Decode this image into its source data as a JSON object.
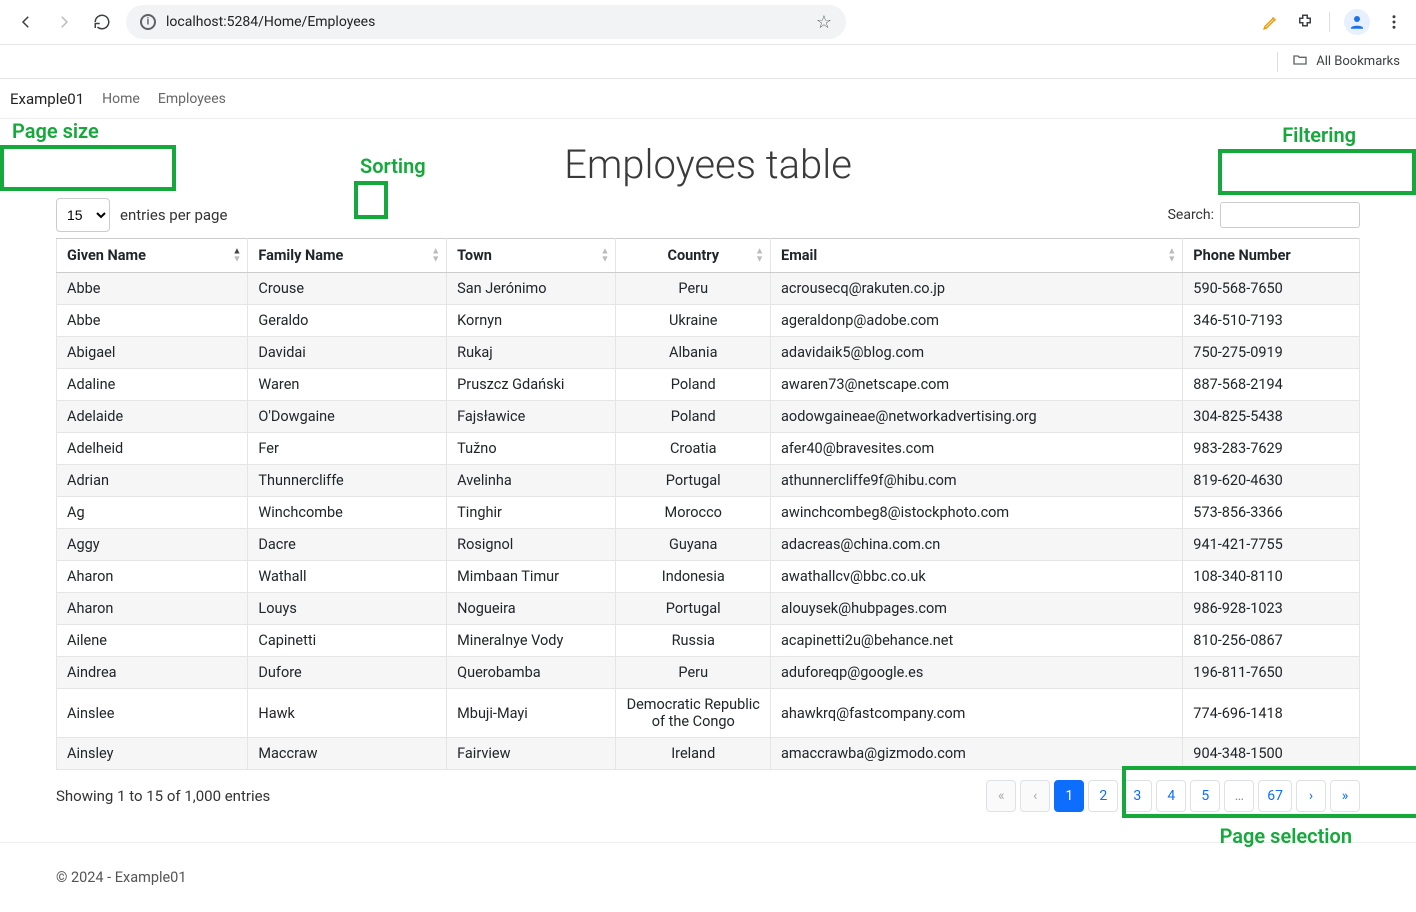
{
  "browser": {
    "url": "localhost:5284/Home/Employees",
    "all_bookmarks": "All Bookmarks"
  },
  "nav": {
    "brand": "Example01",
    "links": [
      "Home",
      "Employees"
    ]
  },
  "annotations": {
    "page_size": "Page size",
    "sorting": "Sorting",
    "filtering": "Filtering",
    "page_selection": "Page selection"
  },
  "page": {
    "title": "Employees table",
    "length_value": "15",
    "length_suffix": "entries per page",
    "search_label": "Search:",
    "search_value": "",
    "info": "Showing 1 to 15 of 1,000 entries"
  },
  "columns": [
    {
      "label": "Given Name",
      "center": false
    },
    {
      "label": "Family Name",
      "center": false
    },
    {
      "label": "Town",
      "center": false
    },
    {
      "label": "Country",
      "center": true
    },
    {
      "label": "Email",
      "center": false
    },
    {
      "label": "Phone Number",
      "center": false
    }
  ],
  "rows": [
    {
      "given": "Abbe",
      "family": "Crouse",
      "town": "San Jerónimo",
      "country": "Peru",
      "email": "acrousecq@rakuten.co.jp",
      "phone": "590-568-7650"
    },
    {
      "given": "Abbe",
      "family": "Geraldo",
      "town": "Kornyn",
      "country": "Ukraine",
      "email": "ageraldonp@adobe.com",
      "phone": "346-510-7193"
    },
    {
      "given": "Abigael",
      "family": "Davidai",
      "town": "Rukaj",
      "country": "Albania",
      "email": "adavidaik5@blog.com",
      "phone": "750-275-0919"
    },
    {
      "given": "Adaline",
      "family": "Waren",
      "town": "Pruszcz Gdański",
      "country": "Poland",
      "email": "awaren73@netscape.com",
      "phone": "887-568-2194"
    },
    {
      "given": "Adelaide",
      "family": "O'Dowgaine",
      "town": "Fajsławice",
      "country": "Poland",
      "email": "aodowgaineae@networkadvertising.org",
      "phone": "304-825-5438"
    },
    {
      "given": "Adelheid",
      "family": "Fer",
      "town": "Tužno",
      "country": "Croatia",
      "email": "afer40@bravesites.com",
      "phone": "983-283-7629"
    },
    {
      "given": "Adrian",
      "family": "Thunnercliffe",
      "town": "Avelinha",
      "country": "Portugal",
      "email": "athunnercliffe9f@hibu.com",
      "phone": "819-620-4630"
    },
    {
      "given": "Ag",
      "family": "Winchcombe",
      "town": "Tinghir",
      "country": "Morocco",
      "email": "awinchcombeg8@istockphoto.com",
      "phone": "573-856-3366"
    },
    {
      "given": "Aggy",
      "family": "Dacre",
      "town": "Rosignol",
      "country": "Guyana",
      "email": "adacreas@china.com.cn",
      "phone": "941-421-7755"
    },
    {
      "given": "Aharon",
      "family": "Wathall",
      "town": "Mimbaan Timur",
      "country": "Indonesia",
      "email": "awathallcv@bbc.co.uk",
      "phone": "108-340-8110"
    },
    {
      "given": "Aharon",
      "family": "Louys",
      "town": "Nogueira",
      "country": "Portugal",
      "email": "alouysek@hubpages.com",
      "phone": "986-928-1023"
    },
    {
      "given": "Ailene",
      "family": "Capinetti",
      "town": "Mineralnye Vody",
      "country": "Russia",
      "email": "acapinetti2u@behance.net",
      "phone": "810-256-0867"
    },
    {
      "given": "Aindrea",
      "family": "Dufore",
      "town": "Querobamba",
      "country": "Peru",
      "email": "aduforeqp@google.es",
      "phone": "196-811-7650"
    },
    {
      "given": "Ainslee",
      "family": "Hawk",
      "town": "Mbuji-Mayi",
      "country": "Democratic Republic of the Congo",
      "email": "ahawkrq@fastcompany.com",
      "phone": "774-696-1418"
    },
    {
      "given": "Ainsley",
      "family": "Maccraw",
      "town": "Fairview",
      "country": "Ireland",
      "email": "amaccrawba@gizmodo.com",
      "phone": "904-348-1500"
    }
  ],
  "pagination": {
    "first": "«",
    "prev": "‹",
    "pages": [
      "1",
      "2",
      "3",
      "4",
      "5"
    ],
    "ellipsis": "…",
    "last_page": "67",
    "next": "›",
    "last": "»",
    "active_index": 0
  },
  "footer": "© 2024 - Example01"
}
